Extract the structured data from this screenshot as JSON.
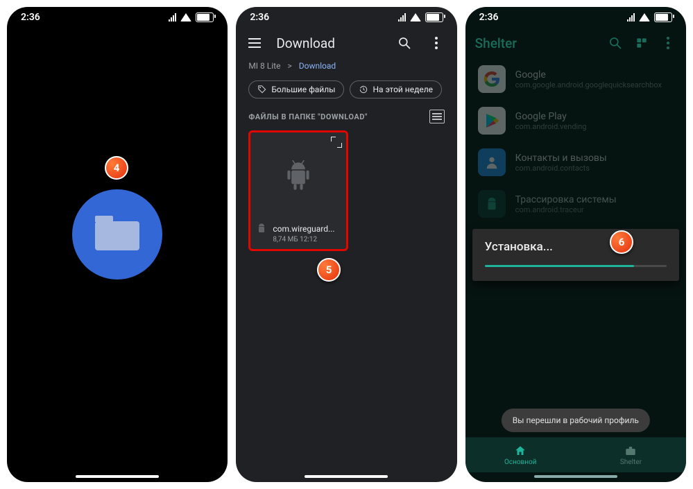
{
  "status_time": "2:36",
  "callouts": {
    "c4": "4",
    "c5": "5",
    "c6": "6"
  },
  "screen2": {
    "title": "Download",
    "crumb_root": "MI 8 Lite",
    "crumb_sep": ">",
    "crumb_current": "Download",
    "chip_big_files": "Большие файлы",
    "chip_this_week": "На этой неделе",
    "section_header": "ФАЙЛЫ В ПАПКЕ \"DOWNLOAD\"",
    "file": {
      "name": "com.wireguard...",
      "meta": "8,74 МБ 12:12"
    }
  },
  "screen3": {
    "app_title": "Shelter",
    "apps": [
      {
        "title": "Google",
        "pkg": "com.google.android.googlequicksearchbox"
      },
      {
        "title": "Google Play",
        "pkg": "com.android.vending"
      },
      {
        "title": "Контакты и вызовы",
        "pkg": "com.android.contacts"
      },
      {
        "title": "Трассировка системы",
        "pkg": "com.android.traceur"
      }
    ],
    "install_title": "Установка...",
    "toast": "Вы перешли в рабочий профиль",
    "tab_main": "Основной",
    "tab_shelter": "Shelter"
  }
}
